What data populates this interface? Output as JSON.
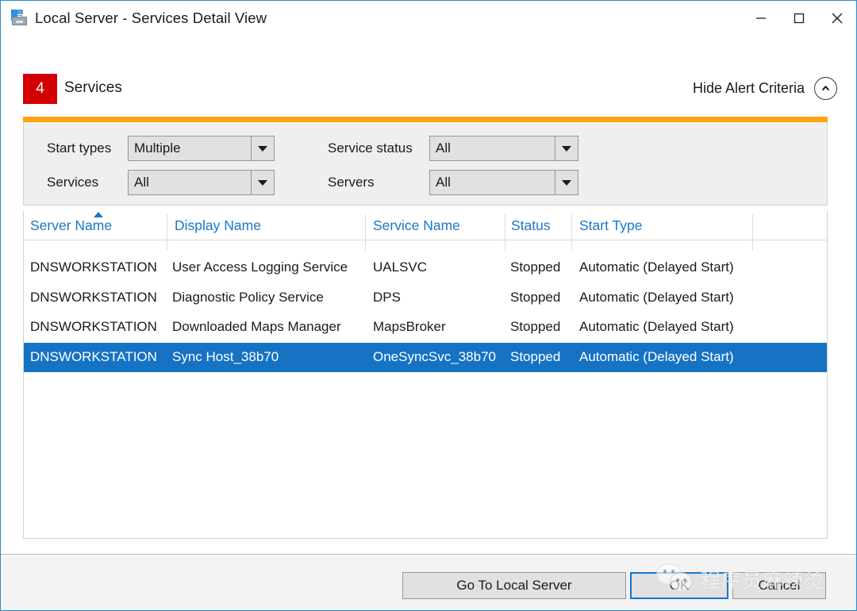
{
  "window": {
    "title": "Local Server - Services Detail View",
    "icon": "server-manager-toolbox-icon",
    "controls": {
      "minimize": "minimize-icon",
      "maximize": "maximize-icon",
      "close": "close-icon"
    },
    "accent_border_color": "#2a8ad4"
  },
  "alert_header": {
    "count": "4",
    "count_badge_color": "#d40000",
    "section_title": "Services",
    "toggle_label": "Hide Alert Criteria",
    "toggle_icon": "chevron-up-icon"
  },
  "filters": {
    "accent_color": "#ffa50f",
    "start_types": {
      "label": "Start types",
      "value": "Multiple"
    },
    "services": {
      "label": "Services",
      "value": "All"
    },
    "service_status": {
      "label": "Service status",
      "value": "All"
    },
    "servers": {
      "label": "Servers",
      "value": "All"
    }
  },
  "table": {
    "header_color": "#1878c8",
    "selection_color": "#1673c4",
    "sort": {
      "column": "Server Name",
      "direction": "ascending"
    },
    "columns": [
      {
        "key": "server_name",
        "label": "Server Name"
      },
      {
        "key": "display_name",
        "label": "Display Name"
      },
      {
        "key": "service_name",
        "label": "Service Name"
      },
      {
        "key": "status",
        "label": "Status"
      },
      {
        "key": "start_type",
        "label": "Start Type"
      }
    ],
    "rows": [
      {
        "server_name": "DNSWORKSTATION",
        "display_name": "User Access Logging Service",
        "service_name": "UALSVC",
        "status": "Stopped",
        "start_type": "Automatic (Delayed Start)",
        "selected": false
      },
      {
        "server_name": "DNSWORKSTATION",
        "display_name": "Diagnostic Policy Service",
        "service_name": "DPS",
        "status": "Stopped",
        "start_type": "Automatic (Delayed Start)",
        "selected": false
      },
      {
        "server_name": "DNSWORKSTATION",
        "display_name": "Downloaded Maps Manager",
        "service_name": "MapsBroker",
        "status": "Stopped",
        "start_type": "Automatic (Delayed Start)",
        "selected": false
      },
      {
        "server_name": "DNSWORKSTATION",
        "display_name": "Sync Host_38b70",
        "service_name": "OneSyncSvc_38b70",
        "status": "Stopped",
        "start_type": "Automatic (Delayed Start)",
        "selected": true
      }
    ]
  },
  "footer": {
    "go_to_local_server": "Go To Local Server",
    "ok": "OK",
    "cancel": "Cancel"
  },
  "watermark": {
    "text": "程序员麻辣烫",
    "icon": "wechat-logo-icon"
  }
}
